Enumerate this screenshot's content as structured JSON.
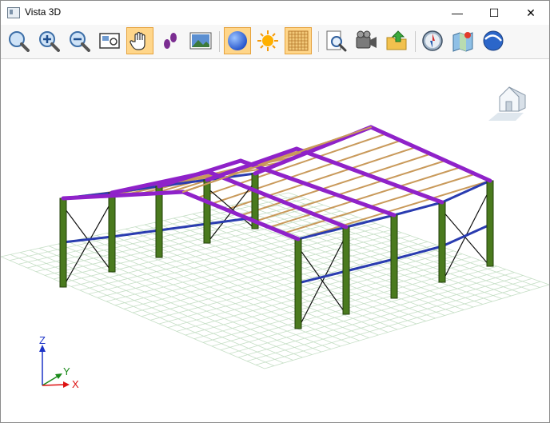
{
  "window": {
    "title": "Vista 3D",
    "minimize_glyph": "—",
    "maximize_glyph": "☐",
    "close_glyph": "✕"
  },
  "toolbar": {
    "buttons": [
      {
        "icon": "zoom-fit-icon",
        "active": false
      },
      {
        "icon": "zoom-in-icon",
        "active": false
      },
      {
        "icon": "zoom-out-icon",
        "active": false
      },
      {
        "icon": "zoom-window-icon",
        "active": false
      },
      {
        "icon": "pan-hand-icon",
        "active": true
      },
      {
        "icon": "walk-footprints-icon",
        "active": false
      },
      {
        "icon": "background-image-icon",
        "active": false
      },
      {
        "icon": "solid-sphere-icon",
        "active": true
      },
      {
        "icon": "light-sun-icon",
        "active": false
      },
      {
        "icon": "grid-icon",
        "active": true
      },
      {
        "icon": "print-preview-icon",
        "active": false
      },
      {
        "icon": "video-camera-icon",
        "active": false
      },
      {
        "icon": "export-folder-icon",
        "active": false
      },
      {
        "icon": "compass-icon",
        "active": false
      },
      {
        "icon": "map-location-icon",
        "active": false
      },
      {
        "icon": "google-earth-icon",
        "active": false
      }
    ]
  },
  "axes": {
    "z": "Z",
    "y": "Y",
    "x": "X"
  },
  "colors": {
    "column": "#4a7a1e",
    "column_edge": "#22400a",
    "rafter": "#8f22c9",
    "purlin": "#c99a5b",
    "girt": "#2a3cb0",
    "bracing": "#111111",
    "grid": "#c6dfc6",
    "active_button": "#ffd68a"
  }
}
